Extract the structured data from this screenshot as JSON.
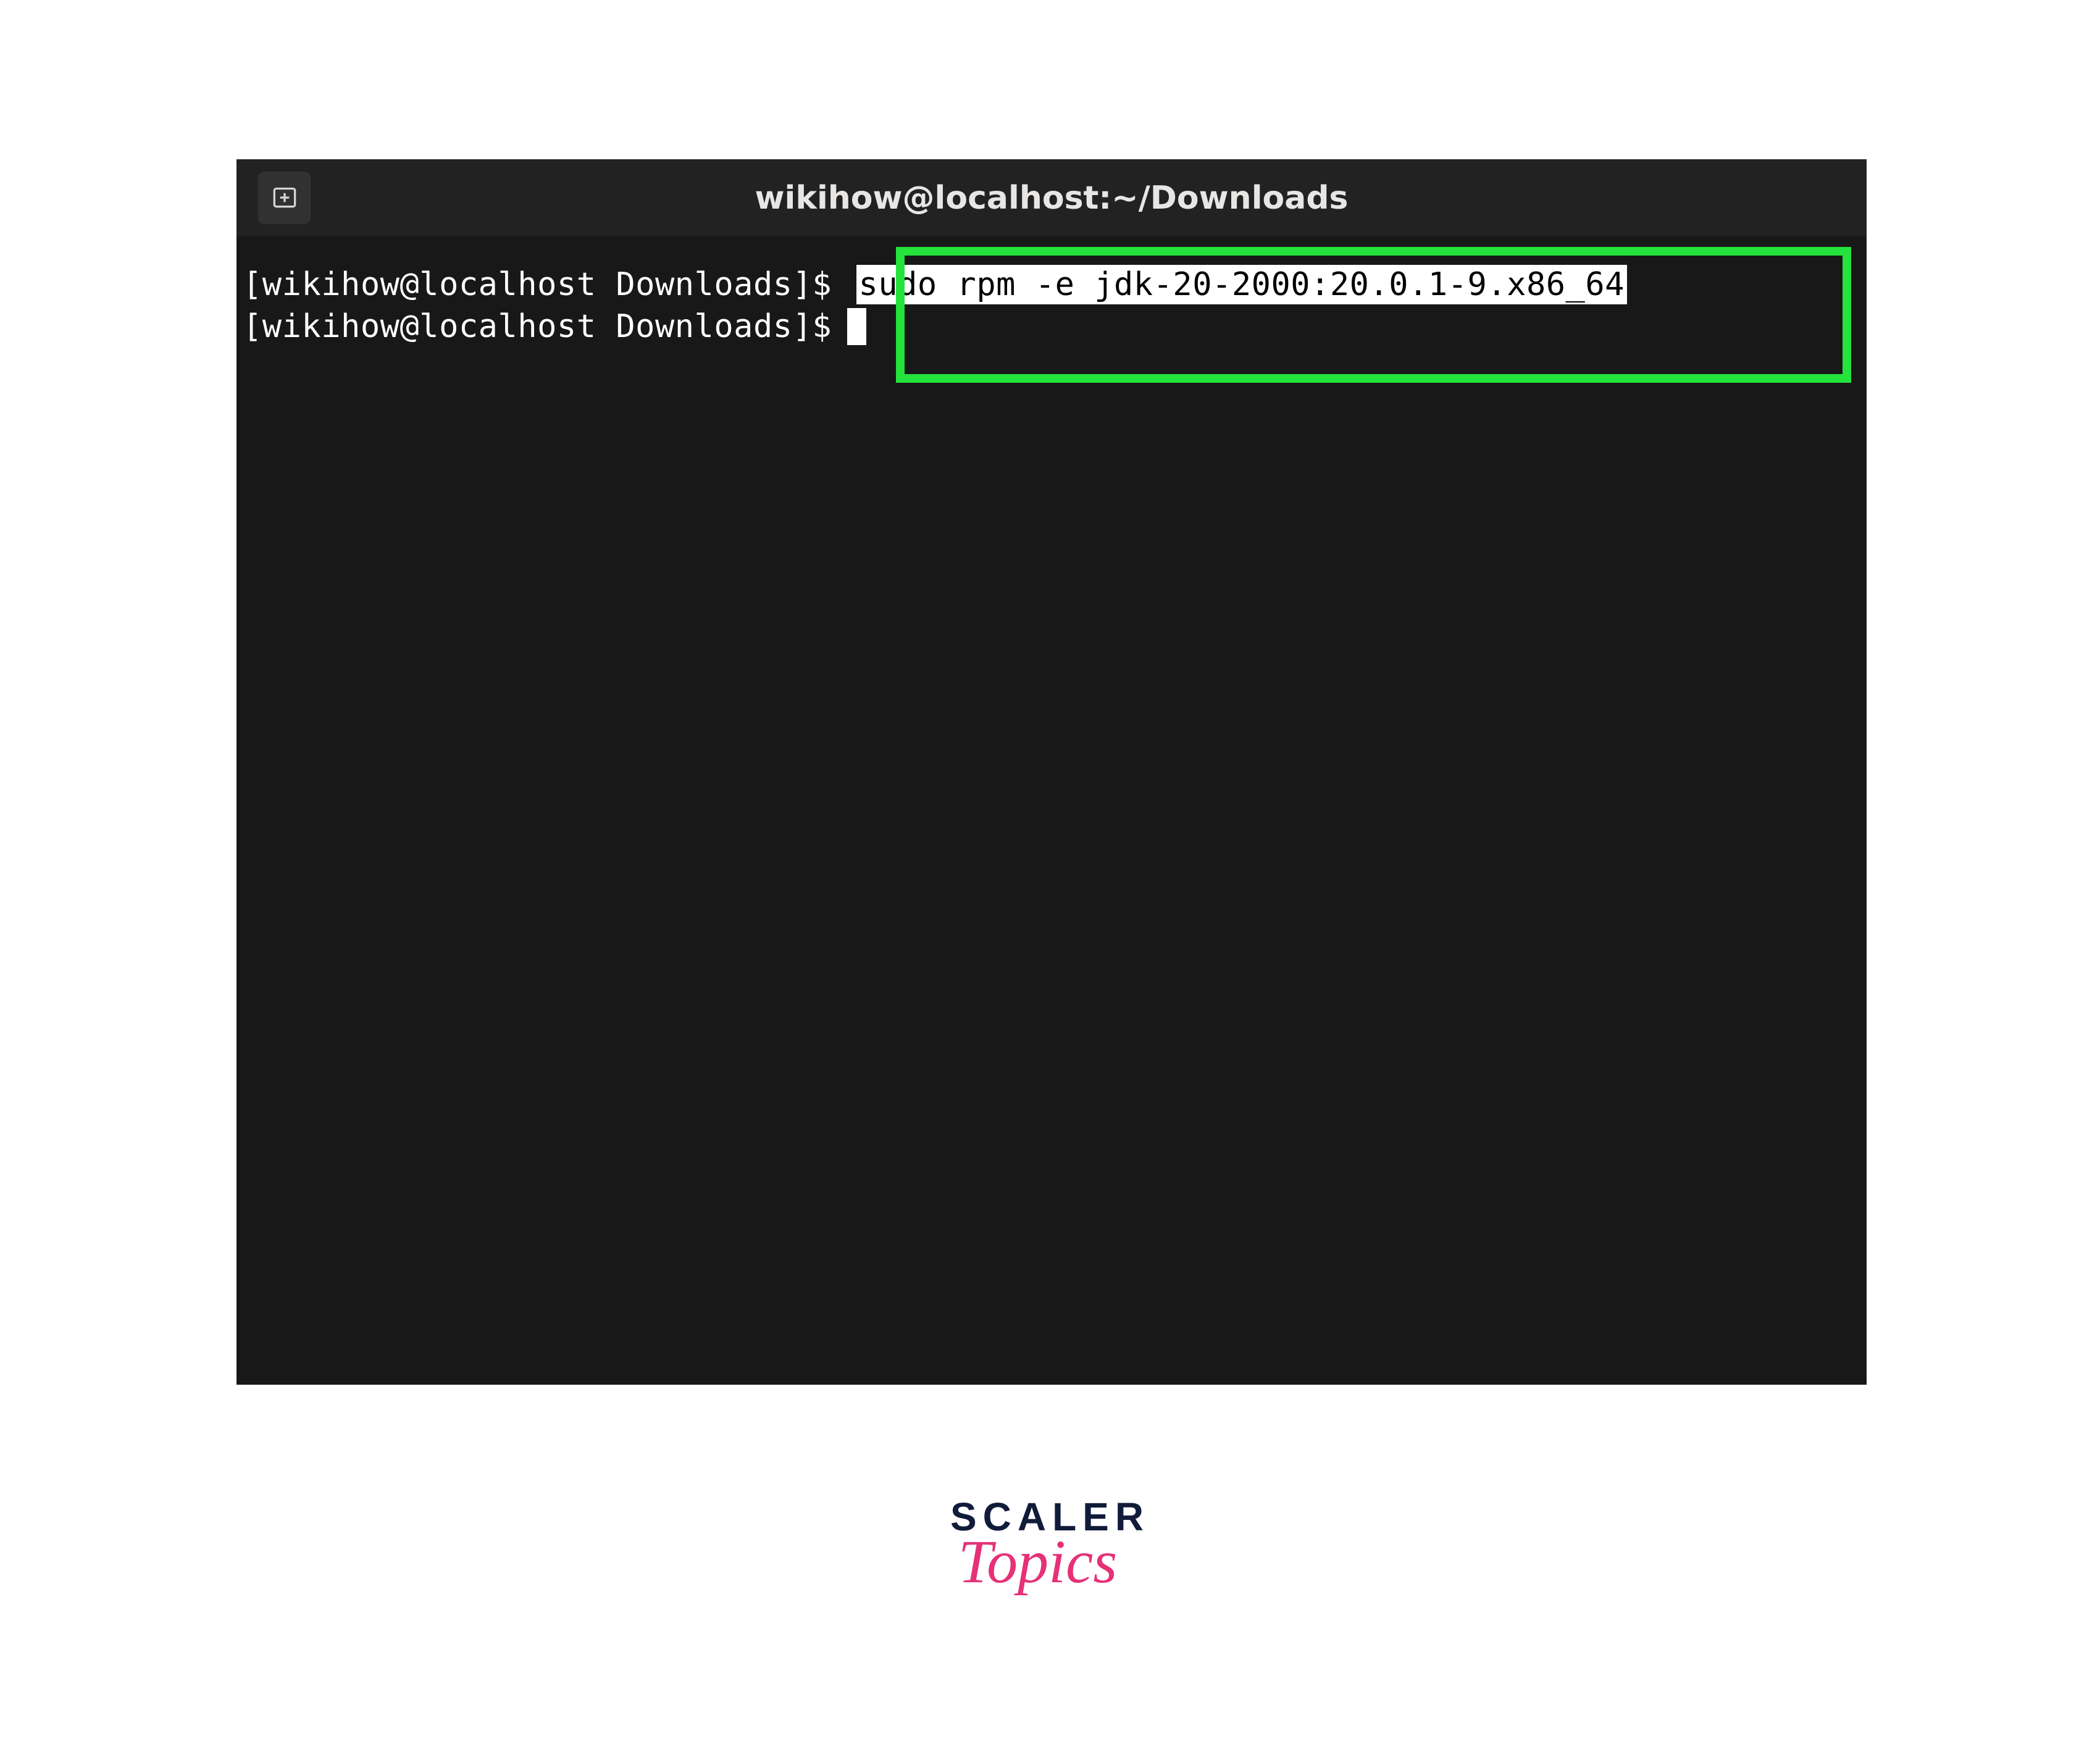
{
  "terminal": {
    "title": "wikihow@localhost:~/Downloads",
    "icon": "new-tab-icon",
    "lines": [
      {
        "prompt": "[wikihow@localhost Downloads]$",
        "command": "sudo rpm -e jdk-20-2000:20.0.1-9.x86_64"
      },
      {
        "prompt": "[wikihow@localhost Downloads]$",
        "command": ""
      }
    ]
  },
  "highlight": {
    "color": "#24e33c"
  },
  "branding": {
    "primary": "SCALER",
    "secondary": "Topics"
  }
}
